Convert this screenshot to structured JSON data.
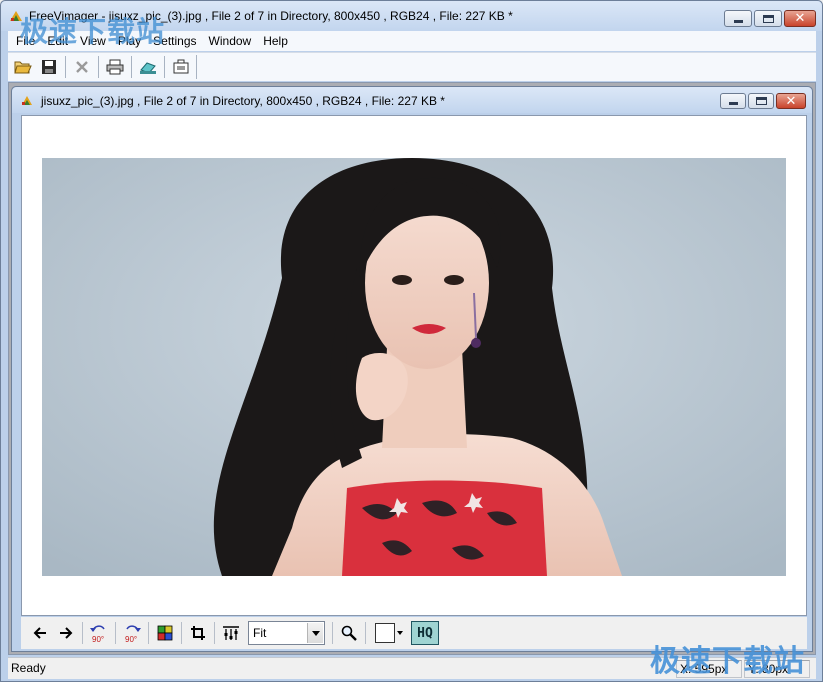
{
  "window": {
    "title": "FreeVimager - jisuxz_pic_(3).jpg , File 2 of 7 in Directory, 800x450 , RGB24 , File: 227 KB *",
    "min_label": "",
    "max_label": "",
    "close_label": "✕"
  },
  "menu": [
    "File",
    "Edit",
    "View",
    "Play",
    "Settings",
    "Window",
    "Help"
  ],
  "toolbar": {
    "icons": [
      "open-folder-icon",
      "save-icon",
      "delete-icon",
      "print-icon",
      "scan-icon",
      "capture-icon"
    ]
  },
  "child": {
    "title": "jisuxz_pic_(3).jpg , File 2 of 7 in Directory, 800x450 , RGB24 , File: 227 KB *",
    "close_label": "✕"
  },
  "view_toolbar": {
    "zoom_value": "Fit",
    "rotate_ccw_label": "90°",
    "rotate_cw_label": "90°",
    "hq_label": "HQ"
  },
  "status": {
    "text": "Ready",
    "x_readout": "X: 595px",
    "y_readout": "Y: 80px"
  },
  "watermark": "极速下载站",
  "colors": {
    "accent": "#bcd0ea",
    "hq_fill": "#9fd4d2"
  }
}
